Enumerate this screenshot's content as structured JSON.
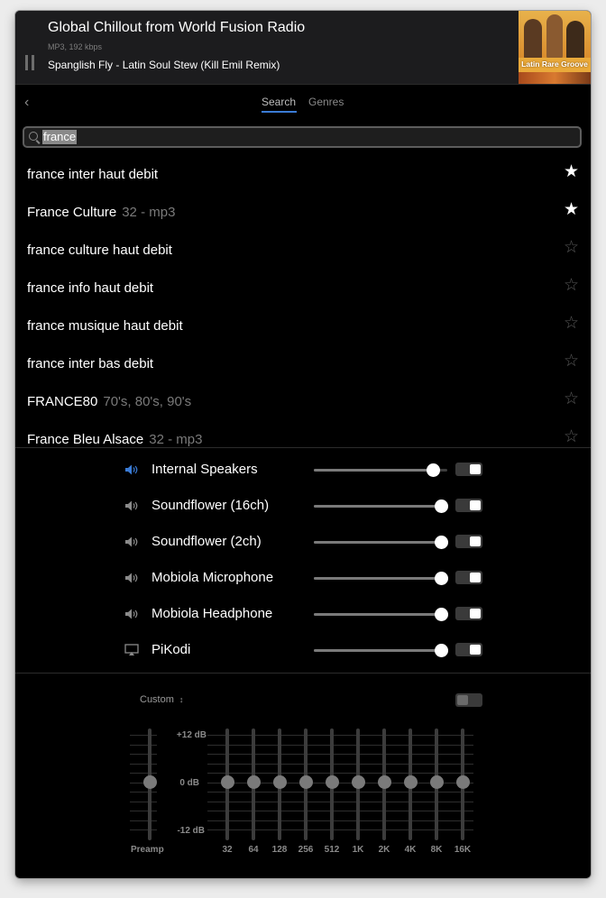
{
  "now_playing": {
    "title": "Global Chillout from World Fusion Radio",
    "meta": "MP3, 192 kbps",
    "track": "Spanglish Fly - Latin Soul Stew (Kill Emil Remix)",
    "album_art_text": "Latin Rare Groove"
  },
  "tabs": [
    {
      "label": "Search",
      "active": true
    },
    {
      "label": "Genres",
      "active": false
    }
  ],
  "search": {
    "value": "france"
  },
  "stations": [
    {
      "name": "france inter haut debit",
      "detail": "",
      "favorite": true
    },
    {
      "name": "France Culture",
      "detail": "32 - mp3",
      "favorite": true
    },
    {
      "name": "france culture haut debit",
      "detail": "",
      "favorite": false
    },
    {
      "name": "france info haut debit",
      "detail": "",
      "favorite": false
    },
    {
      "name": "france musique haut debit",
      "detail": "",
      "favorite": false
    },
    {
      "name": "france inter bas debit",
      "detail": "",
      "favorite": false
    },
    {
      "name": "FRANCE80",
      "detail": "70's, 80's, 90's",
      "favorite": false
    },
    {
      "name": "France Bleu Alsace",
      "detail": "32 - mp3",
      "favorite": false
    }
  ],
  "devices": [
    {
      "name": "Internal Speakers",
      "icon": "speaker-icon",
      "active": true,
      "volume": 0.89,
      "enabled": true
    },
    {
      "name": "Soundflower (16ch)",
      "icon": "speaker-icon",
      "active": false,
      "volume": 0.95,
      "enabled": true
    },
    {
      "name": "Soundflower (2ch)",
      "icon": "speaker-icon",
      "active": false,
      "volume": 0.95,
      "enabled": true
    },
    {
      "name": "Mobiola Microphone",
      "icon": "speaker-icon",
      "active": false,
      "volume": 0.95,
      "enabled": true
    },
    {
      "name": "Mobiola Headphone",
      "icon": "speaker-icon",
      "active": false,
      "volume": 0.95,
      "enabled": true
    },
    {
      "name": "PiKodi",
      "icon": "airplay-icon",
      "active": false,
      "volume": 0.95,
      "enabled": true
    }
  ],
  "equalizer": {
    "preset": "Custom",
    "enabled": false,
    "db_labels": [
      "+12 dB",
      "0 dB",
      "-12 dB"
    ],
    "preamp_label": "Preamp",
    "preamp_db": 0,
    "bands": [
      {
        "label": "32",
        "db": 0
      },
      {
        "label": "64",
        "db": 0
      },
      {
        "label": "128",
        "db": 0
      },
      {
        "label": "256",
        "db": 0
      },
      {
        "label": "512",
        "db": 0
      },
      {
        "label": "1K",
        "db": 0
      },
      {
        "label": "2K",
        "db": 0
      },
      {
        "label": "4K",
        "db": 0
      },
      {
        "label": "8K",
        "db": 0
      },
      {
        "label": "16K",
        "db": 0
      }
    ]
  },
  "colors": {
    "accent": "#3a7bd5",
    "background": "#000000",
    "header": "#1c1c1e"
  }
}
